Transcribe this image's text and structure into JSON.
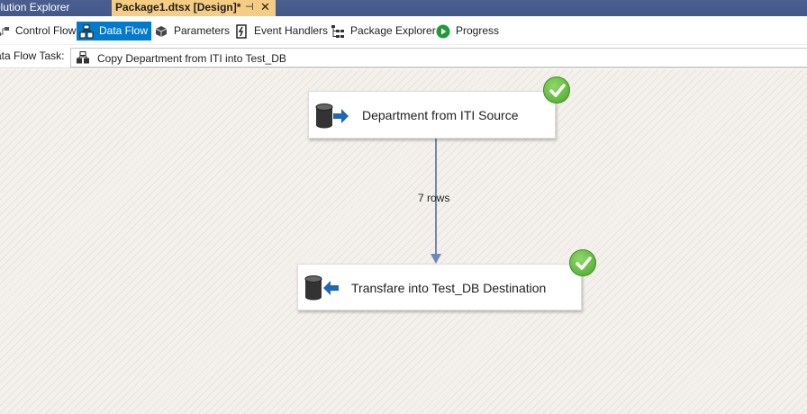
{
  "doc_tabs": {
    "solution_explorer": "olution Explorer",
    "active_tab": "Package1.dtsx [Design]*",
    "pin_glyph": "⊣",
    "close_glyph": "✕"
  },
  "designer_tabs": [
    {
      "label": "Control Flow",
      "icon": "control-flow-icon"
    },
    {
      "label": "Data Flow",
      "icon": "data-flow-icon",
      "active": true
    },
    {
      "label": "Parameters",
      "icon": "parameters-icon"
    },
    {
      "label": "Event Handlers",
      "icon": "event-handlers-icon"
    },
    {
      "label": "Package Explorer",
      "icon": "package-explorer-icon"
    },
    {
      "label": "Progress",
      "icon": "progress-play-icon"
    }
  ],
  "task_bar": {
    "label": "ata Flow Task:",
    "value": "Copy Department from ITI into Test_DB"
  },
  "canvas": {
    "source": {
      "label": "Department from ITI Source",
      "status": "success"
    },
    "destination": {
      "label": "Transfare into Test_DB Destination",
      "status": "success"
    },
    "path": {
      "label": "7 rows"
    }
  },
  "colors": {
    "active_tab_bg": "#007acc",
    "doc_tab_active": "#f5cc84",
    "doc_tab_strip": "#43588a",
    "path_line": "#6f87b3",
    "success": "#4aa82a"
  }
}
